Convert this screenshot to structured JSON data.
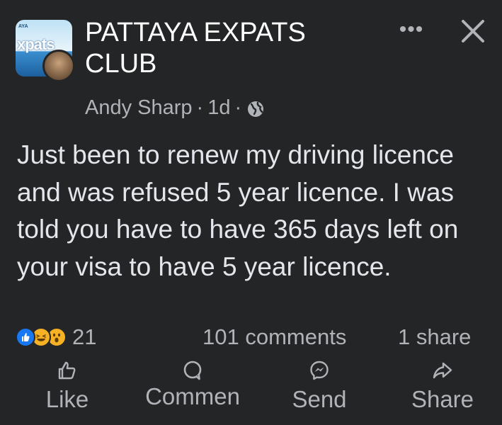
{
  "header": {
    "group_name": "PATTAYA EXPATS CLUB",
    "avatar_logo_text": "xpats",
    "avatar_logo_small": "AYA",
    "author": "Andy Sharp",
    "time": "1d",
    "separator": "·",
    "privacy_icon": "globe-icon",
    "more_icon": "more-options-icon",
    "more_glyph": "•••",
    "close_icon": "close-icon"
  },
  "post": {
    "text": "Just been to renew my driving licence and was refused 5 year licence. I was told you have to have 365 days left on your visa to have 5 year licence."
  },
  "stats": {
    "reaction_icons": [
      "like-reaction-icon",
      "haha-reaction-icon",
      "wow-reaction-icon"
    ],
    "reaction_count": "21",
    "comments": "101 comments",
    "shares": "1 share"
  },
  "actions": {
    "like": "Like",
    "comment": "Commen",
    "send": "Send",
    "share": "Share"
  },
  "colors": {
    "background": "#242526",
    "primary_text": "#e4e6eb",
    "secondary_text": "#b0b3b8",
    "like_blue": "#1877f2",
    "reaction_yellow": "#f7b125"
  }
}
